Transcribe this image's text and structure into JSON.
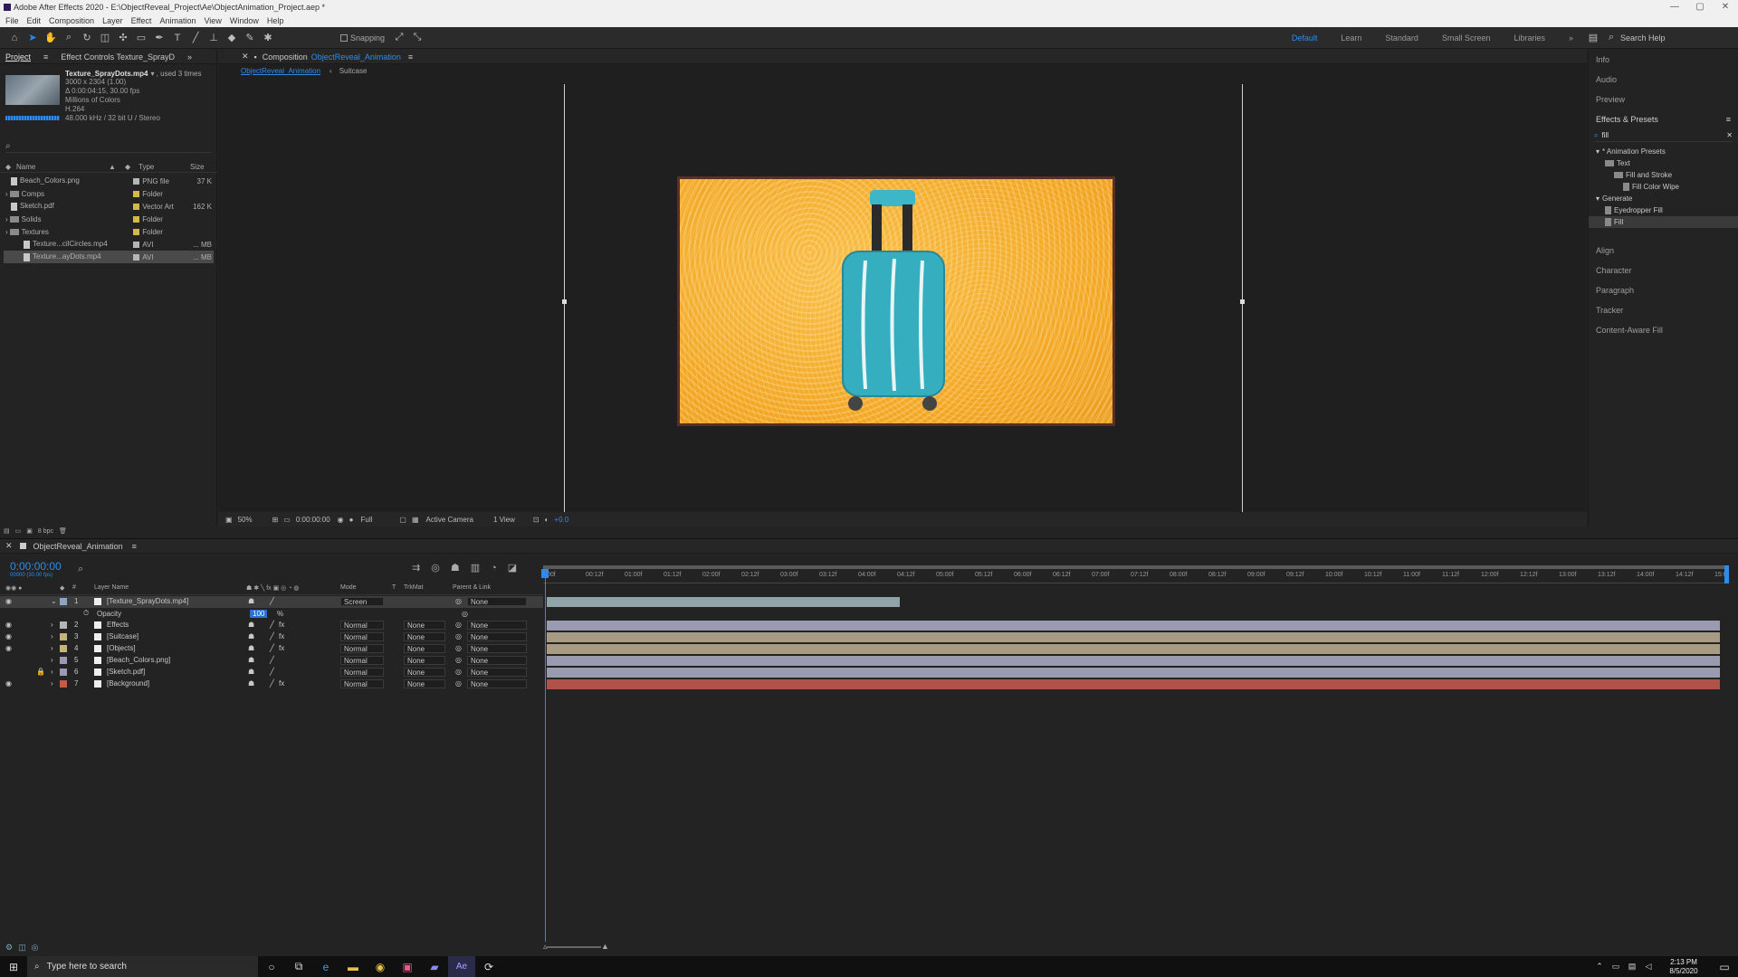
{
  "titlebar": {
    "text": "Adobe After Effects 2020 - E:\\ObjectReveal_Project\\Ae\\ObjectAnimation_Project.aep *",
    "min": "—",
    "max": "▢",
    "close": "✕"
  },
  "menu": [
    "File",
    "Edit",
    "Composition",
    "Layer",
    "Effect",
    "Animation",
    "View",
    "Window",
    "Help"
  ],
  "toolbar": {
    "snapping": "Snapping",
    "workspaces": [
      "Default",
      "Learn",
      "Standard",
      "Small Screen",
      "Libraries"
    ],
    "more": "»",
    "search_help": "Search Help"
  },
  "project": {
    "tabs": [
      "Project",
      "Effect Controls Texture_SprayD"
    ],
    "menu_icon": "≡",
    "more": "»",
    "selected": {
      "name": "Texture_SprayDots.mp4",
      "used": "▾ , used 3 times",
      "info": [
        "3000 x 2304 (1.00)",
        "Δ 0:00:04:15, 30.00 fps",
        "Millions of Colors",
        "H.264",
        "48.000 kHz / 32 bit U / Stereo"
      ]
    },
    "columns": [
      "Name",
      "Type",
      "Size"
    ],
    "items": [
      {
        "name": "Beach_Colors.png",
        "type": "PNG file",
        "size": "37 K",
        "kind": "file",
        "color": "#b5b5b5",
        "indent": 0
      },
      {
        "name": "Comps",
        "type": "Folder",
        "size": "",
        "kind": "folder",
        "color": "#d4b84a",
        "indent": 0
      },
      {
        "name": "Sketch.pdf",
        "type": "Vector Art",
        "size": "162 K",
        "kind": "file",
        "color": "#d4b84a",
        "indent": 0
      },
      {
        "name": "Solids",
        "type": "Folder",
        "size": "",
        "kind": "folder",
        "color": "#d4b84a",
        "indent": 0
      },
      {
        "name": "Textures",
        "type": "Folder",
        "size": "",
        "kind": "folder",
        "color": "#d4b84a",
        "indent": 0
      },
      {
        "name": "Texture...cilCircles.mp4",
        "type": "AVI",
        "size": "... MB",
        "kind": "file",
        "color": "#b5b5b5",
        "indent": 1
      },
      {
        "name": "Texture...ayDots.mp4",
        "type": "AVI",
        "size": "... MB",
        "kind": "file",
        "color": "#b5b5b5",
        "indent": 1
      }
    ],
    "bpc": "8 bpc"
  },
  "composition": {
    "tab": "Composition",
    "tab_name": "ObjectReveal_Animation",
    "menu_icon": "≡",
    "breadcrumbs": [
      "ObjectReveal_Animation",
      "Suitcase"
    ],
    "footer": {
      "zoom": "50%",
      "timecode": "0:00:00:00",
      "resolution": "Full",
      "camera": "Active Camera",
      "views": "1 View",
      "exposure": "+0.0"
    }
  },
  "right_panel": {
    "top_items": [
      "Info",
      "Audio",
      "Preview"
    ],
    "effects_title": "Effects & Presets",
    "menu_icon": "≡",
    "search": "fill",
    "clear": "✕",
    "tree": [
      {
        "label": "* Animation Presets",
        "indent": 0
      },
      {
        "label": "Text",
        "indent": 1
      },
      {
        "label": "Fill and Stroke",
        "indent": 2
      },
      {
        "label": "Fill Color Wipe",
        "indent": 3
      },
      {
        "label": "Generate",
        "indent": 0
      },
      {
        "label": "Eyedropper Fill",
        "indent": 1
      },
      {
        "label": "Fill",
        "indent": 1
      }
    ],
    "bottom_items": [
      "Align",
      "Character",
      "Paragraph",
      "Tracker",
      "Content-Aware Fill"
    ]
  },
  "timeline": {
    "tab": "ObjectReveal_Animation",
    "menu_icon": "≡",
    "timecode": "0:00:00:00",
    "subcode": "00000 (30.00 fps)",
    "cols": {
      "num": "#",
      "name": "Layer Name",
      "mode": "Mode",
      "t": "T",
      "trkmat": "TrkMat",
      "parent": "Parent & Link"
    },
    "ruler": [
      "00f",
      "00:12f",
      "01:00f",
      "01:12f",
      "02:00f",
      "02:12f",
      "03:00f",
      "03:12f",
      "04:00f",
      "04:12f",
      "05:00f",
      "05:12f",
      "06:00f",
      "06:12f",
      "07:00f",
      "07:12f",
      "08:00f",
      "08:12f",
      "09:00f",
      "09:12f",
      "10:00f",
      "10:12f",
      "11:00f",
      "11:12f",
      "12:00f",
      "12:12f",
      "13:00f",
      "13:12f",
      "14:00f",
      "14:12f",
      "15:0"
    ],
    "layers": [
      {
        "num": "1",
        "name": "[Texture_SprayDots.mp4]",
        "mode": "Screen",
        "trkmat": "",
        "parent": "None",
        "color": "#8aa6c4",
        "bar": "#8fa3a8",
        "fx": false,
        "eye": true
      },
      {
        "num": "2",
        "name": "Effects",
        "mode": "Normal",
        "trkmat": "None",
        "parent": "None",
        "color": "#b5b5b5",
        "bar": "#9a9bb0",
        "fx": true,
        "eye": true
      },
      {
        "num": "3",
        "name": "[Suitcase]",
        "mode": "Normal",
        "trkmat": "None",
        "parent": "None",
        "color": "#c9b27a",
        "bar": "#a89b84",
        "fx": true,
        "eye": true
      },
      {
        "num": "4",
        "name": "[Objects]",
        "mode": "Normal",
        "trkmat": "None",
        "parent": "None",
        "color": "#c9b27a",
        "bar": "#a89b84",
        "fx": true,
        "eye": true
      },
      {
        "num": "5",
        "name": "[Beach_Colors.png]",
        "mode": "Normal",
        "trkmat": "None",
        "parent": "None",
        "color": "#9a9ab8",
        "bar": "#9a9bb0",
        "fx": false,
        "eye": false
      },
      {
        "num": "6",
        "name": "[Sketch.pdf]",
        "mode": "Normal",
        "trkmat": "None",
        "parent": "None",
        "color": "#9a9ab8",
        "bar": "#9a9bb0",
        "fx": false,
        "eye": false
      },
      {
        "num": "7",
        "name": "[Background]",
        "mode": "Normal",
        "trkmat": "None",
        "parent": "None",
        "color": "#c45a4a",
        "bar": "#b0524a",
        "fx": true,
        "eye": true
      }
    ],
    "opacity_label": "Opacity",
    "opacity_value": "100",
    "opacity_unit": "%"
  },
  "taskbar": {
    "search": "Type here to search",
    "time": "2:13 PM",
    "date": "8/5/2020"
  }
}
